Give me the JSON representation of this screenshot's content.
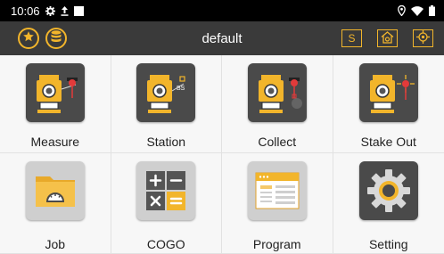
{
  "status_bar": {
    "time": "10:06",
    "icons_left": [
      "gear-icon",
      "upload-icon",
      "square-icon"
    ],
    "icons_right": [
      "location-icon",
      "wifi-icon",
      "battery-icon"
    ]
  },
  "app_bar": {
    "title": "default",
    "left_buttons": [
      "favorite-star-icon",
      "database-icon"
    ],
    "s_button_label": "S",
    "right_buttons": [
      "s-button",
      "home-settings-icon",
      "target-icon"
    ]
  },
  "colors": {
    "accent": "#f2b52b",
    "appbar_bg": "#3a3a3a",
    "statusbar_bg": "#000000",
    "tile_bg": "#f7f7f7",
    "icon_bg": "#4a4a4a"
  },
  "menu": {
    "items": [
      {
        "label": "Measure",
        "icon": "measure-instrument-icon"
      },
      {
        "label": "Station",
        "icon": "station-instrument-icon"
      },
      {
        "label": "Collect",
        "icon": "collect-instrument-icon"
      },
      {
        "label": "Stake Out",
        "icon": "stakeout-instrument-icon"
      },
      {
        "label": "Job",
        "icon": "job-folder-icon"
      },
      {
        "label": "COGO",
        "icon": "calculator-icon"
      },
      {
        "label": "Program",
        "icon": "program-window-icon"
      },
      {
        "label": "Setting",
        "icon": "settings-gear-icon"
      }
    ]
  }
}
